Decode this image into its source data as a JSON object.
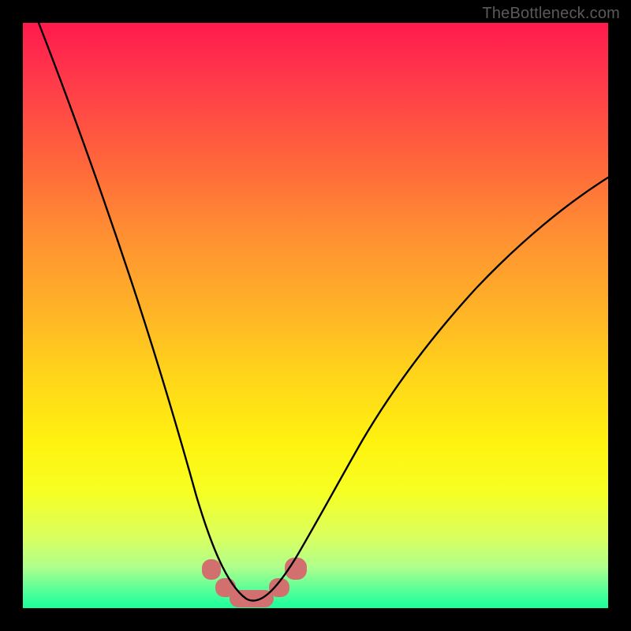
{
  "watermark": {
    "text": "TheBottleneck.com"
  },
  "chart_data": {
    "type": "line",
    "title": "",
    "xlabel": "",
    "ylabel": "",
    "xlim": [
      0,
      100
    ],
    "ylim": [
      0,
      100
    ],
    "grid": false,
    "legend": false,
    "series": [
      {
        "name": "bottleneck-curve",
        "color": "#000000",
        "x": [
          0,
          5,
          10,
          15,
          20,
          25,
          27,
          30,
          32.5,
          35,
          37,
          38.5,
          40,
          43,
          47,
          52,
          58,
          65,
          73,
          82,
          92,
          100
        ],
        "y": [
          100,
          85,
          70,
          55,
          40,
          25,
          17,
          10,
          6,
          3,
          1.5,
          1.2,
          1.5,
          3,
          7,
          14,
          23,
          33,
          43,
          53,
          63,
          71
        ]
      }
    ],
    "markers": [
      {
        "name": "segment-1",
        "shape": "rounded",
        "x_range": [
          31.0,
          33.5
        ],
        "y_range": [
          5.5,
          8.5
        ],
        "color": "#d2706f"
      },
      {
        "name": "segment-2",
        "shape": "rounded",
        "x_range": [
          33.0,
          36.0
        ],
        "y_range": [
          2.0,
          5.0
        ],
        "color": "#d2706f"
      },
      {
        "name": "segment-3",
        "shape": "rounded",
        "x_range": [
          36.0,
          42.5
        ],
        "y_range": [
          0.5,
          3.0
        ],
        "color": "#d2706f"
      },
      {
        "name": "segment-4",
        "shape": "rounded",
        "x_range": [
          42.0,
          45.0
        ],
        "y_range": [
          2.0,
          5.0
        ],
        "color": "#d2706f"
      },
      {
        "name": "segment-5",
        "shape": "rounded",
        "x_range": [
          45.0,
          48.5
        ],
        "y_range": [
          5.5,
          9.0
        ],
        "color": "#d2706f"
      }
    ],
    "background_gradient_stops": [
      {
        "pos": 0,
        "color": "#ff1a4d"
      },
      {
        "pos": 25,
        "color": "#ff6a3a"
      },
      {
        "pos": 50,
        "color": "#ffb028"
      },
      {
        "pos": 72,
        "color": "#fff310"
      },
      {
        "pos": 88,
        "color": "#d9ff60"
      },
      {
        "pos": 100,
        "color": "#1aff9c"
      }
    ]
  }
}
